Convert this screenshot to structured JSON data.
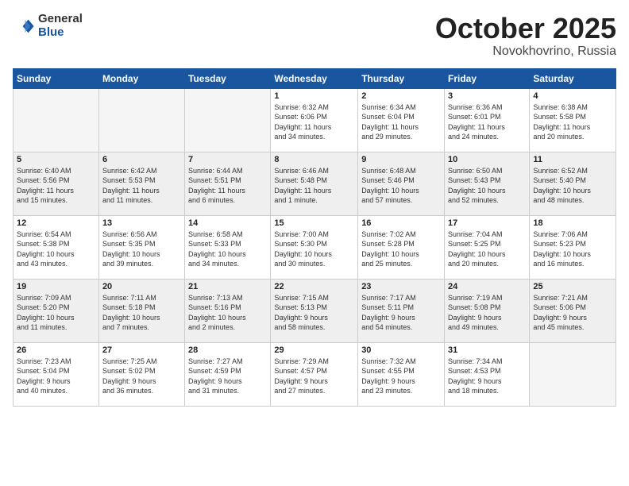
{
  "logo": {
    "general": "General",
    "blue": "Blue"
  },
  "header": {
    "month": "October 2025",
    "location": "Novokhovrino, Russia"
  },
  "weekdays": [
    "Sunday",
    "Monday",
    "Tuesday",
    "Wednesday",
    "Thursday",
    "Friday",
    "Saturday"
  ],
  "weeks": [
    [
      {
        "day": "",
        "info": ""
      },
      {
        "day": "",
        "info": ""
      },
      {
        "day": "",
        "info": ""
      },
      {
        "day": "1",
        "info": "Sunrise: 6:32 AM\nSunset: 6:06 PM\nDaylight: 11 hours\nand 34 minutes."
      },
      {
        "day": "2",
        "info": "Sunrise: 6:34 AM\nSunset: 6:04 PM\nDaylight: 11 hours\nand 29 minutes."
      },
      {
        "day": "3",
        "info": "Sunrise: 6:36 AM\nSunset: 6:01 PM\nDaylight: 11 hours\nand 24 minutes."
      },
      {
        "day": "4",
        "info": "Sunrise: 6:38 AM\nSunset: 5:58 PM\nDaylight: 11 hours\nand 20 minutes."
      }
    ],
    [
      {
        "day": "5",
        "info": "Sunrise: 6:40 AM\nSunset: 5:56 PM\nDaylight: 11 hours\nand 15 minutes."
      },
      {
        "day": "6",
        "info": "Sunrise: 6:42 AM\nSunset: 5:53 PM\nDaylight: 11 hours\nand 11 minutes."
      },
      {
        "day": "7",
        "info": "Sunrise: 6:44 AM\nSunset: 5:51 PM\nDaylight: 11 hours\nand 6 minutes."
      },
      {
        "day": "8",
        "info": "Sunrise: 6:46 AM\nSunset: 5:48 PM\nDaylight: 11 hours\nand 1 minute."
      },
      {
        "day": "9",
        "info": "Sunrise: 6:48 AM\nSunset: 5:46 PM\nDaylight: 10 hours\nand 57 minutes."
      },
      {
        "day": "10",
        "info": "Sunrise: 6:50 AM\nSunset: 5:43 PM\nDaylight: 10 hours\nand 52 minutes."
      },
      {
        "day": "11",
        "info": "Sunrise: 6:52 AM\nSunset: 5:40 PM\nDaylight: 10 hours\nand 48 minutes."
      }
    ],
    [
      {
        "day": "12",
        "info": "Sunrise: 6:54 AM\nSunset: 5:38 PM\nDaylight: 10 hours\nand 43 minutes."
      },
      {
        "day": "13",
        "info": "Sunrise: 6:56 AM\nSunset: 5:35 PM\nDaylight: 10 hours\nand 39 minutes."
      },
      {
        "day": "14",
        "info": "Sunrise: 6:58 AM\nSunset: 5:33 PM\nDaylight: 10 hours\nand 34 minutes."
      },
      {
        "day": "15",
        "info": "Sunrise: 7:00 AM\nSunset: 5:30 PM\nDaylight: 10 hours\nand 30 minutes."
      },
      {
        "day": "16",
        "info": "Sunrise: 7:02 AM\nSunset: 5:28 PM\nDaylight: 10 hours\nand 25 minutes."
      },
      {
        "day": "17",
        "info": "Sunrise: 7:04 AM\nSunset: 5:25 PM\nDaylight: 10 hours\nand 20 minutes."
      },
      {
        "day": "18",
        "info": "Sunrise: 7:06 AM\nSunset: 5:23 PM\nDaylight: 10 hours\nand 16 minutes."
      }
    ],
    [
      {
        "day": "19",
        "info": "Sunrise: 7:09 AM\nSunset: 5:20 PM\nDaylight: 10 hours\nand 11 minutes."
      },
      {
        "day": "20",
        "info": "Sunrise: 7:11 AM\nSunset: 5:18 PM\nDaylight: 10 hours\nand 7 minutes."
      },
      {
        "day": "21",
        "info": "Sunrise: 7:13 AM\nSunset: 5:16 PM\nDaylight: 10 hours\nand 2 minutes."
      },
      {
        "day": "22",
        "info": "Sunrise: 7:15 AM\nSunset: 5:13 PM\nDaylight: 9 hours\nand 58 minutes."
      },
      {
        "day": "23",
        "info": "Sunrise: 7:17 AM\nSunset: 5:11 PM\nDaylight: 9 hours\nand 54 minutes."
      },
      {
        "day": "24",
        "info": "Sunrise: 7:19 AM\nSunset: 5:08 PM\nDaylight: 9 hours\nand 49 minutes."
      },
      {
        "day": "25",
        "info": "Sunrise: 7:21 AM\nSunset: 5:06 PM\nDaylight: 9 hours\nand 45 minutes."
      }
    ],
    [
      {
        "day": "26",
        "info": "Sunrise: 7:23 AM\nSunset: 5:04 PM\nDaylight: 9 hours\nand 40 minutes."
      },
      {
        "day": "27",
        "info": "Sunrise: 7:25 AM\nSunset: 5:02 PM\nDaylight: 9 hours\nand 36 minutes."
      },
      {
        "day": "28",
        "info": "Sunrise: 7:27 AM\nSunset: 4:59 PM\nDaylight: 9 hours\nand 31 minutes."
      },
      {
        "day": "29",
        "info": "Sunrise: 7:29 AM\nSunset: 4:57 PM\nDaylight: 9 hours\nand 27 minutes."
      },
      {
        "day": "30",
        "info": "Sunrise: 7:32 AM\nSunset: 4:55 PM\nDaylight: 9 hours\nand 23 minutes."
      },
      {
        "day": "31",
        "info": "Sunrise: 7:34 AM\nSunset: 4:53 PM\nDaylight: 9 hours\nand 18 minutes."
      },
      {
        "day": "",
        "info": ""
      }
    ]
  ]
}
